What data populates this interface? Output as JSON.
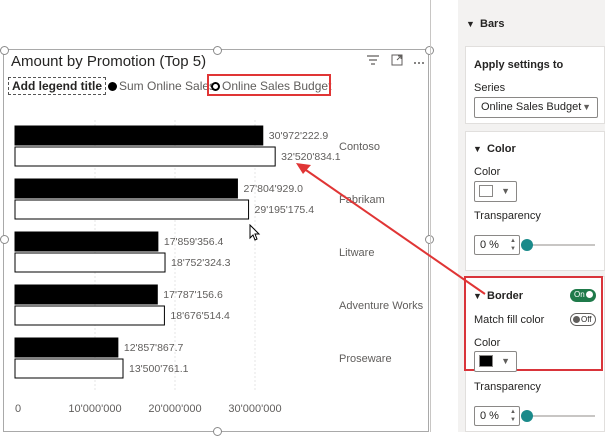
{
  "visual": {
    "title": "Amount by Promotion (Top 5)",
    "icons": [
      "filter-icon",
      "focus-mode-icon",
      "more-options-icon"
    ]
  },
  "legend": {
    "title": "Add legend title",
    "items": [
      {
        "label": "Sum Online Sales",
        "marker": "filled"
      },
      {
        "label": "Online Sales Budget",
        "marker": "hollow"
      }
    ]
  },
  "chart_data": {
    "type": "bar",
    "orientation": "horizontal",
    "categories": [
      "Contoso",
      "Fabrikam",
      "Litware",
      "Adventure Works",
      "Proseware"
    ],
    "series": [
      {
        "name": "Sum Online Sales",
        "values": [
          30972222.9,
          27804929.0,
          17859356.4,
          17787156.6,
          12857867.7
        ],
        "labels": [
          "30'972'222.9",
          "27'804'929.0",
          "17'859'356.4",
          "17'787'156.6",
          "12'857'867.7"
        ],
        "fill": "#000000"
      },
      {
        "name": "Online Sales Budget",
        "values": [
          32520834.1,
          29195175.4,
          18752324.3,
          18676514.4,
          13500761.1
        ],
        "labels": [
          "32'520'834.1",
          "29'195'175.4",
          "18'752'324.3",
          "18'676'514.4",
          "13'500'761.1"
        ],
        "fill": "#ffffff",
        "border": "#000000"
      }
    ],
    "x_ticks": [
      "0",
      "10'000'000",
      "20'000'000",
      "30'000'000"
    ],
    "x_tick_values": [
      0,
      10000000,
      20000000,
      30000000
    ],
    "xlim": [
      0,
      35000000
    ]
  },
  "format_pane": {
    "bars_section": {
      "label": "Bars"
    },
    "apply_settings": {
      "title": "Apply settings to",
      "series_label": "Series",
      "series_value": "Online Sales Budget"
    },
    "color_section": {
      "title": "Color",
      "color_label": "Color",
      "color_value": "#ffffff",
      "transparency_label": "Transparency",
      "transparency_value": "0 %"
    },
    "border_section": {
      "title": "Border",
      "toggle_state": "On",
      "match_fill_label": "Match fill color",
      "match_fill_state": "Off",
      "color_label": "Color",
      "color_value": "#000000",
      "transparency_label": "Transparency",
      "transparency_value": "0 %"
    }
  },
  "colors": {
    "highlight": "#e03535",
    "accent": "#1a8a8a",
    "toggle_on": "#1f7a4a"
  }
}
